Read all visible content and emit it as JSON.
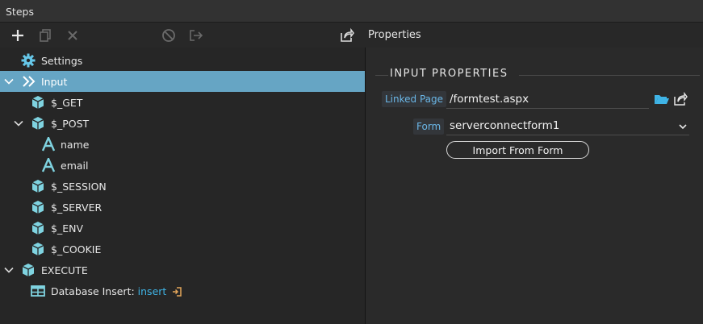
{
  "panel": {
    "title": "Steps"
  },
  "toolbar": {
    "add": "add-icon",
    "copy": "copy-icon",
    "delete": "delete-icon",
    "disable": "disable-icon",
    "export": "export-icon",
    "share": "share-icon",
    "properties_label": "Properties"
  },
  "tree": {
    "settings": "Settings",
    "input": "Input",
    "get": "$_GET",
    "post": "$_POST",
    "name": "name",
    "email": "email",
    "session": "$_SESSION",
    "server": "$_SERVER",
    "env": "$_ENV",
    "cookie": "$_COOKIE",
    "execute": "EXECUTE",
    "db_insert_prefix": "Database Insert: ",
    "db_insert_name": "insert"
  },
  "properties": {
    "section_title": "INPUT PROPERTIES",
    "linked_page_label": "Linked Page",
    "linked_page_value": "/formtest.aspx",
    "form_label": "Form",
    "form_value": "serverconnectform1",
    "import_button": "Import From Form"
  },
  "colors": {
    "selection": "#66a5c4",
    "accent_cyan": "#7fd3e0",
    "link_blue": "#3fb4e6",
    "field_label": "#6ab6e6"
  }
}
